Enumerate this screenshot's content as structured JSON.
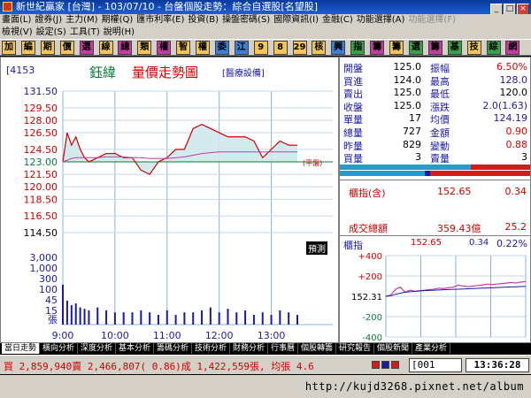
{
  "window": {
    "title": "新世紀贏家 [台灣] - 103/07/10 - 台盤個股走勢：綜合自選股[名望股]"
  },
  "menu": {
    "row1": [
      "畫面(L)",
      "證券(J)",
      "主力(M)",
      "期權(Q)",
      "匯市利率(E)",
      "投資(B)",
      "操盤密碼(S)",
      "國際資訊(I)",
      "金融(C)",
      "功能選擇(A)",
      "功能選擇(F)"
    ],
    "row2": [
      "檢視(V)",
      "設定(S)",
      "工具(T)",
      "說明(H)"
    ],
    "disabled": [
      "功能選擇(F)"
    ]
  },
  "toolbar": {
    "buttons": [
      {
        "label": "加",
        "color": "#f2c45a"
      },
      {
        "label": "編",
        "color": "#f2c45a"
      },
      {
        "label": "期",
        "color": "#f2c45a"
      },
      {
        "label": "價",
        "color": "#f2c45a"
      },
      {
        "label": "選",
        "color": "#c33ca0"
      },
      {
        "label": "線",
        "color": "#f2c45a"
      },
      {
        "label": "總",
        "color": "#c33ca0"
      },
      {
        "label": "類",
        "color": "#f2c45a"
      },
      {
        "label": "權",
        "color": "#c33ca0"
      },
      {
        "label": "智",
        "color": "#f2c45a"
      },
      {
        "label": "權",
        "color": "#f2c45a"
      },
      {
        "label": "委",
        "color": "#3c7fd3"
      },
      {
        "label": "江",
        "color": "#3c7fd3"
      },
      {
        "label": "9",
        "color": "#f2c45a"
      },
      {
        "label": "8",
        "color": "#f2c45a"
      },
      {
        "label": "29",
        "color": "#f2c45a"
      },
      {
        "label": "核",
        "color": "#f2c45a"
      },
      {
        "label": "興",
        "color": "#3c7fd3"
      },
      {
        "label": "指",
        "color": "#3aa048"
      },
      {
        "label": "籌",
        "color": "#c33ca0"
      },
      {
        "label": "籌",
        "color": "#f2c45a"
      },
      {
        "label": "選",
        "color": "#3aa048"
      },
      {
        "label": "籌",
        "color": "#c33ca0"
      },
      {
        "label": "基",
        "color": "#3aa048"
      },
      {
        "label": "技",
        "color": "#f2c45a"
      },
      {
        "label": "綜",
        "color": "#3aa048"
      },
      {
        "label": "網",
        "color": "#c33ca0"
      }
    ]
  },
  "stock": {
    "code": "[4153",
    "name": "鈺緯",
    "chart_title": "量價走勢圖",
    "category": "[醫療設備]",
    "ref_label": "(平盤)",
    "forecast_label": "預測"
  },
  "chart_data": {
    "type": "line",
    "x_ticks": [
      "9:00",
      "10:00",
      "11:00",
      "12:00",
      "13:00"
    ],
    "price_ticks": [
      "131.50",
      "129.50",
      "128.00",
      "126.50",
      "124.50",
      "123.00",
      "121.50",
      "120.00",
      "118.50",
      "116.50",
      "114.50"
    ],
    "price_ylim": [
      114.5,
      131.5
    ],
    "reference_price": 123.0,
    "volume_ticks": [
      "3,000",
      "1,000",
      "300",
      "100",
      "45",
      "15",
      "張"
    ],
    "x": [
      "9:00",
      "9:05",
      "9:10",
      "9:15",
      "9:20",
      "9:25",
      "9:30",
      "9:40",
      "9:50",
      "10:00",
      "10:10",
      "10:20",
      "10:30",
      "10:40",
      "10:50",
      "11:00",
      "11:10",
      "11:20",
      "11:30",
      "11:40",
      "11:50",
      "12:00",
      "12:10",
      "12:20",
      "12:30",
      "12:40",
      "12:50",
      "13:00",
      "13:10",
      "13:20",
      "13:30"
    ],
    "series": [
      {
        "values": [
          123.0,
          126.5,
          125.0,
          126.0,
          124.5,
          123.5,
          123.0,
          123.5,
          124.0,
          124.0,
          123.5,
          123.5,
          122.0,
          121.5,
          123.0,
          123.5,
          124.5,
          124.5,
          127.0,
          127.5,
          127.0,
          126.5,
          126.0,
          126.0,
          126.0,
          125.5,
          123.5,
          124.5,
          125.5,
          125.0,
          125.0
        ]
      },
      {
        "values": [
          123.0,
          123.2,
          123.4,
          123.5,
          123.5,
          123.5,
          123.5,
          123.5,
          123.6,
          123.6,
          123.6,
          123.5,
          123.5,
          123.4,
          123.4,
          123.4,
          123.5,
          123.6,
          123.8,
          124.0,
          124.1,
          124.2,
          124.2,
          124.2,
          124.2,
          124.2,
          124.2,
          124.2,
          124.2,
          124.2,
          124.19
        ]
      }
    ],
    "volumes": [
      90,
      14,
      8,
      10,
      6,
      5,
      4,
      6,
      4,
      3,
      3,
      3,
      4,
      3,
      2,
      4,
      2,
      3,
      3,
      4,
      6,
      3,
      5,
      3,
      4,
      2,
      3,
      2,
      4,
      3,
      2
    ]
  },
  "quote": {
    "rows": [
      {
        "l1": "開盤",
        "v1": "125.0",
        "l2": "振幅",
        "v2": "6.50%",
        "c2": "#e00000"
      },
      {
        "l1": "買進",
        "v1": "124.0",
        "l2": "最高",
        "v2": "128.0",
        "c2": "#1a1aa6"
      },
      {
        "l1": "賣出",
        "v1": "125.0",
        "l2": "最低",
        "v2": "120.0",
        "c2": "#000000"
      },
      {
        "l1": "收盤",
        "v1": "125.0",
        "l2": "漲跌",
        "v2": "2.0(1.63)",
        "c2": "#1a1aa6"
      },
      {
        "l1": "單量",
        "v1": "17",
        "l2": "均價",
        "v2": "124.19",
        "c2": "#1a1aa6"
      },
      {
        "l1": "總量",
        "v1": "727",
        "l2": "金額",
        "v2": "0.90",
        "c2": "#e00000"
      },
      {
        "l1": "昨量",
        "v1": "829",
        "l2": "變動",
        "v2": "0.88",
        "c2": "#e00000"
      },
      {
        "l1": "買量",
        "v1": "3",
        "l2": "賣量",
        "v2": "3",
        "c2": "#000000"
      }
    ]
  },
  "index_box": {
    "label": "櫃指(含)",
    "value": "152.65",
    "change": "0.34",
    "turnover_label": "成交總額",
    "turnover_value": "359.43億",
    "turnover_change": "25.2"
  },
  "index_chart": {
    "label": "櫃指",
    "value": "152.65",
    "change": "0.34",
    "pct": "0.22%",
    "y_ticks": [
      "+400",
      "+200",
      "152.31",
      "-200",
      "-400"
    ],
    "values": [
      0,
      10,
      70,
      90,
      40,
      60,
      50,
      55,
      60,
      65,
      70,
      80,
      75,
      85,
      90,
      110,
      100,
      95,
      100,
      105,
      110,
      120,
      115,
      120,
      125,
      130,
      135,
      130,
      140,
      145
    ],
    "avg_values": [
      0,
      5,
      20,
      30,
      40,
      45,
      48,
      52,
      55,
      58,
      60,
      62,
      64,
      66,
      68,
      70,
      72,
      74,
      76,
      78,
      80,
      82,
      84,
      86,
      88,
      90,
      92,
      94,
      96,
      98
    ]
  },
  "tabs": [
    "當日走勢",
    "橫向分析",
    "深度分析",
    "基本分析",
    "籌碼分析",
    "技術分析",
    "財務分析",
    "行事曆",
    "個股轉籌",
    "研究報告",
    "個股新聞",
    "產業分析"
  ],
  "status": {
    "ticker": "買 2,859,940賣 2,466,807( 0.86)成 1,422,559張, 均張 4.6",
    "code": "[001",
    "time": "13:36:28"
  },
  "watermark": "http://kujd3268.pixnet.net/album"
}
